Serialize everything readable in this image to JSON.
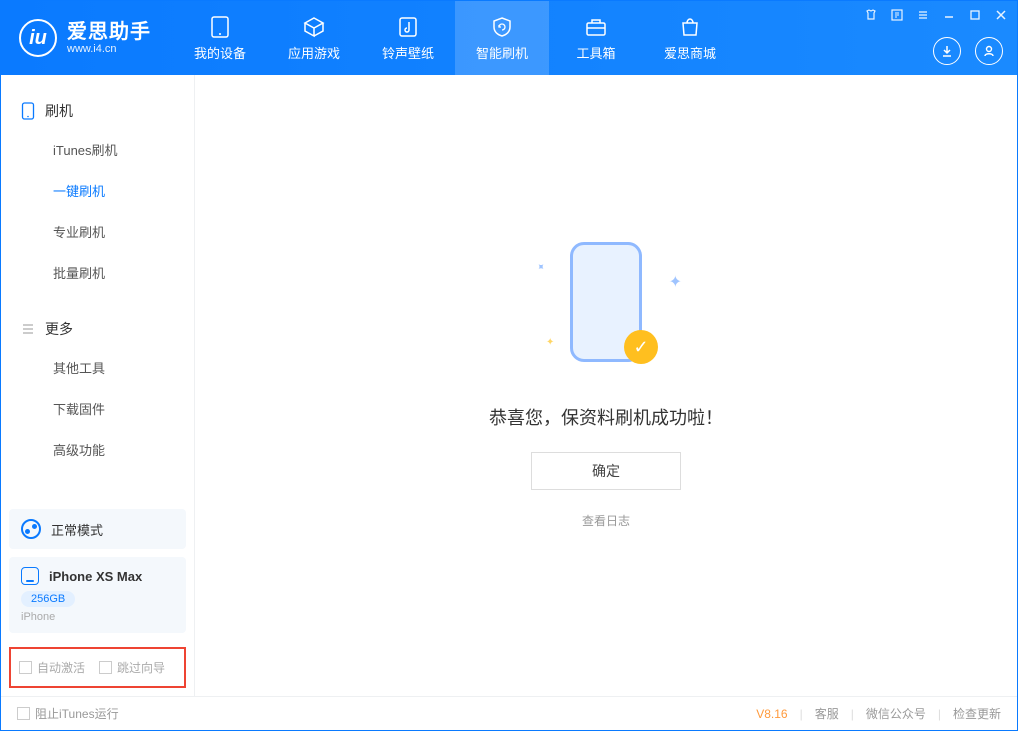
{
  "app": {
    "name": "爱思助手",
    "domain": "www.i4.cn"
  },
  "tabs": {
    "device": "我的设备",
    "apps": "应用游戏",
    "ringtones": "铃声壁纸",
    "flash": "智能刷机",
    "toolbox": "工具箱",
    "store": "爱思商城"
  },
  "sidebar": {
    "group_flash": "刷机",
    "items_flash": {
      "itunes": "iTunes刷机",
      "oneclick": "一键刷机",
      "pro": "专业刷机",
      "batch": "批量刷机"
    },
    "group_more": "更多",
    "items_more": {
      "other": "其他工具",
      "firmware": "下载固件",
      "advanced": "高级功能"
    }
  },
  "mode": {
    "label": "正常模式"
  },
  "device": {
    "name": "iPhone XS Max",
    "capacity": "256GB",
    "type": "iPhone"
  },
  "options": {
    "auto_activate": "自动激活",
    "skip_guide": "跳过向导"
  },
  "main": {
    "message": "恭喜您，保资料刷机成功啦！",
    "ok": "确定",
    "view_log": "查看日志"
  },
  "footer": {
    "block_itunes": "阻止iTunes运行",
    "version": "V8.16",
    "service": "客服",
    "wechat": "微信公众号",
    "update": "检查更新"
  }
}
